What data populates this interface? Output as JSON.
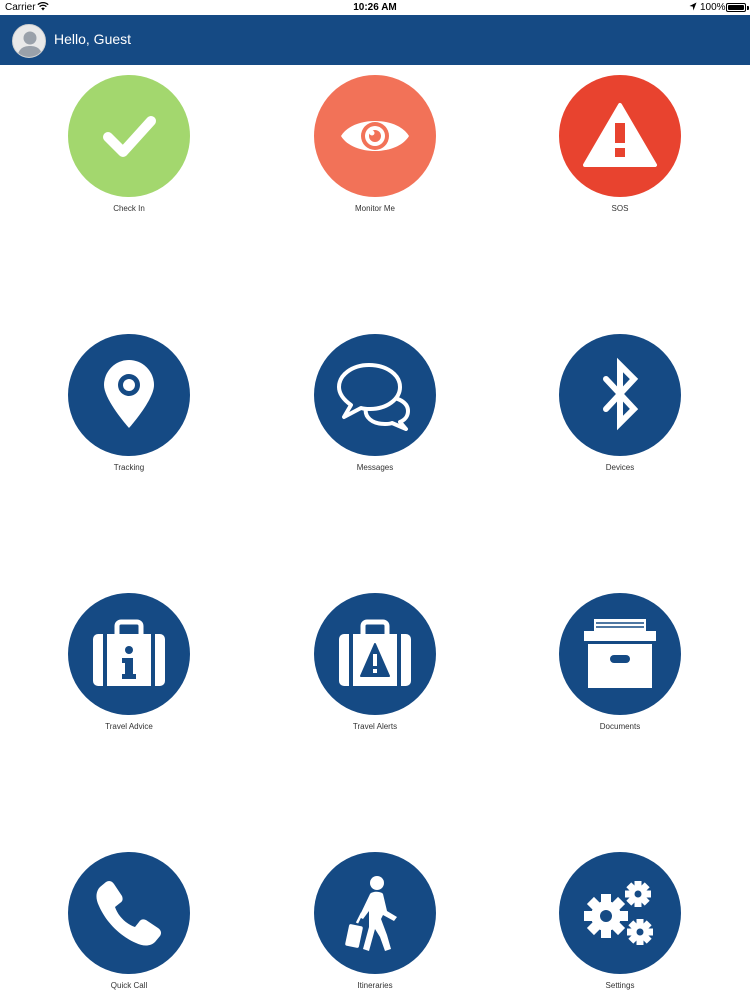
{
  "status_bar": {
    "carrier": "Carrier",
    "time": "10:26 AM",
    "battery": "100%"
  },
  "header": {
    "greeting": "Hello, Guest",
    "background": "#154a84"
  },
  "tiles": [
    {
      "label": "Check In",
      "icon": "checkmark-icon",
      "color": "#a3d76e"
    },
    {
      "label": "Monitor Me",
      "icon": "eye-icon",
      "color": "#f27258"
    },
    {
      "label": "SOS",
      "icon": "warning-icon",
      "color": "#e8432f"
    },
    {
      "label": "Tracking",
      "icon": "location-pin-icon",
      "color": "#154a84"
    },
    {
      "label": "Messages",
      "icon": "chat-bubbles-icon",
      "color": "#154a84"
    },
    {
      "label": "Devices",
      "icon": "bluetooth-icon",
      "color": "#154a84"
    },
    {
      "label": "Travel Advice",
      "icon": "suitcase-info-icon",
      "color": "#154a84"
    },
    {
      "label": "Travel Alerts",
      "icon": "suitcase-alert-icon",
      "color": "#154a84"
    },
    {
      "label": "Documents",
      "icon": "archive-box-icon",
      "color": "#154a84"
    },
    {
      "label": "Quick Call",
      "icon": "phone-icon",
      "color": "#154a84"
    },
    {
      "label": "Itineraries",
      "icon": "traveler-luggage-icon",
      "color": "#154a84"
    },
    {
      "label": "Settings",
      "icon": "gears-icon",
      "color": "#154a84"
    }
  ]
}
